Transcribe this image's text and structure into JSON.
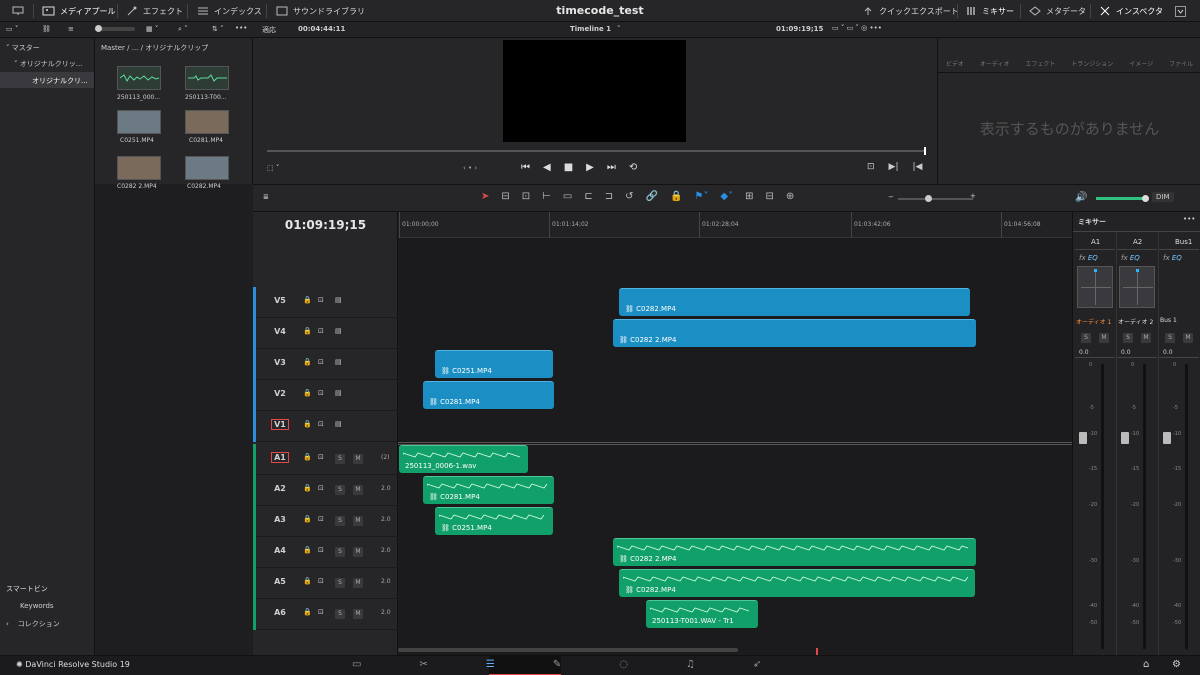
{
  "window": {
    "title": "timecode_test"
  },
  "toolbar": {
    "media_pool": "メディアプール",
    "effects": "エフェクト",
    "index": "インデックス",
    "sound_library": "サウンドライブラリ",
    "quick_export": "クイックエクスポート",
    "mixer": "ミキサー",
    "metadata": "メタデータ",
    "inspector": "インスペクタ"
  },
  "subbar": {
    "fit": "適応",
    "timecode": "00:04:44:11",
    "timeline": "Timeline 1",
    "viewer_tc": "01:09:19;15"
  },
  "bins": {
    "master": "マスター",
    "original_clip": "オリジナルクリッ...",
    "original_clip_selected": "オリジナルクリ...",
    "smart_bins": "スマートビン",
    "keywords": "Keywords",
    "collections": "コレクション"
  },
  "breadcrumb": {
    "text": "Master / ... / オリジナルクリップ"
  },
  "media": [
    {
      "name": "250113_000..."
    },
    {
      "name": "250113-T00..."
    },
    {
      "name": "C0251.MP4"
    },
    {
      "name": "C0281.MP4"
    },
    {
      "name": "C0282 2.MP4"
    },
    {
      "name": "C0282.MP4"
    }
  ],
  "inspector": {
    "tabs": [
      "ビデオ",
      "オーディオ",
      "エフェクト",
      "トランジション",
      "イメージ",
      "ファイル"
    ],
    "empty": "表示するものがありません"
  },
  "timeline": {
    "timecode": "01:09:19;15",
    "ruler": [
      "01:00:00;00",
      "01:01:14;02",
      "01:02:28;04",
      "01:03:42;06",
      "01:04:56;08"
    ],
    "video_tracks": [
      "V5",
      "V4",
      "V3",
      "V2",
      "V1"
    ],
    "audio_tracks": [
      "A1",
      "A2",
      "A3",
      "A4",
      "A5",
      "A6"
    ],
    "audio_levels": [
      "(2)",
      "2.0",
      "2.0",
      "2.0",
      "2.0",
      "2.0"
    ],
    "clips": {
      "v5": "C0282.MP4",
      "v4": "C0282 2.MP4",
      "v3": "C0251.MP4",
      "v2": "C0281.MP4",
      "a1": "250113_0006-1.wav",
      "a2": "C0281.MP4",
      "a3": "C0251.MP4",
      "a4": "C0282 2.MP4",
      "a5": "C0282.MP4",
      "a6": "250113-T001.WAV - Tr1"
    }
  },
  "mixer": {
    "title": "ミキサー",
    "channels": [
      "A1",
      "A2",
      "Bus1"
    ],
    "channel_names": [
      "オーディオ 1",
      "オーディオ 2",
      "Bus 1"
    ],
    "value": "0.0",
    "scale": [
      "0",
      "-5",
      "-10",
      "-15",
      "-20",
      "-30",
      "-40",
      "-50"
    ],
    "dim": "DIM",
    "fx": "fx",
    "eq": "EQ",
    "s": "S",
    "m": "M"
  },
  "footer": {
    "app": "DaVinci Resolve Studio 19"
  }
}
